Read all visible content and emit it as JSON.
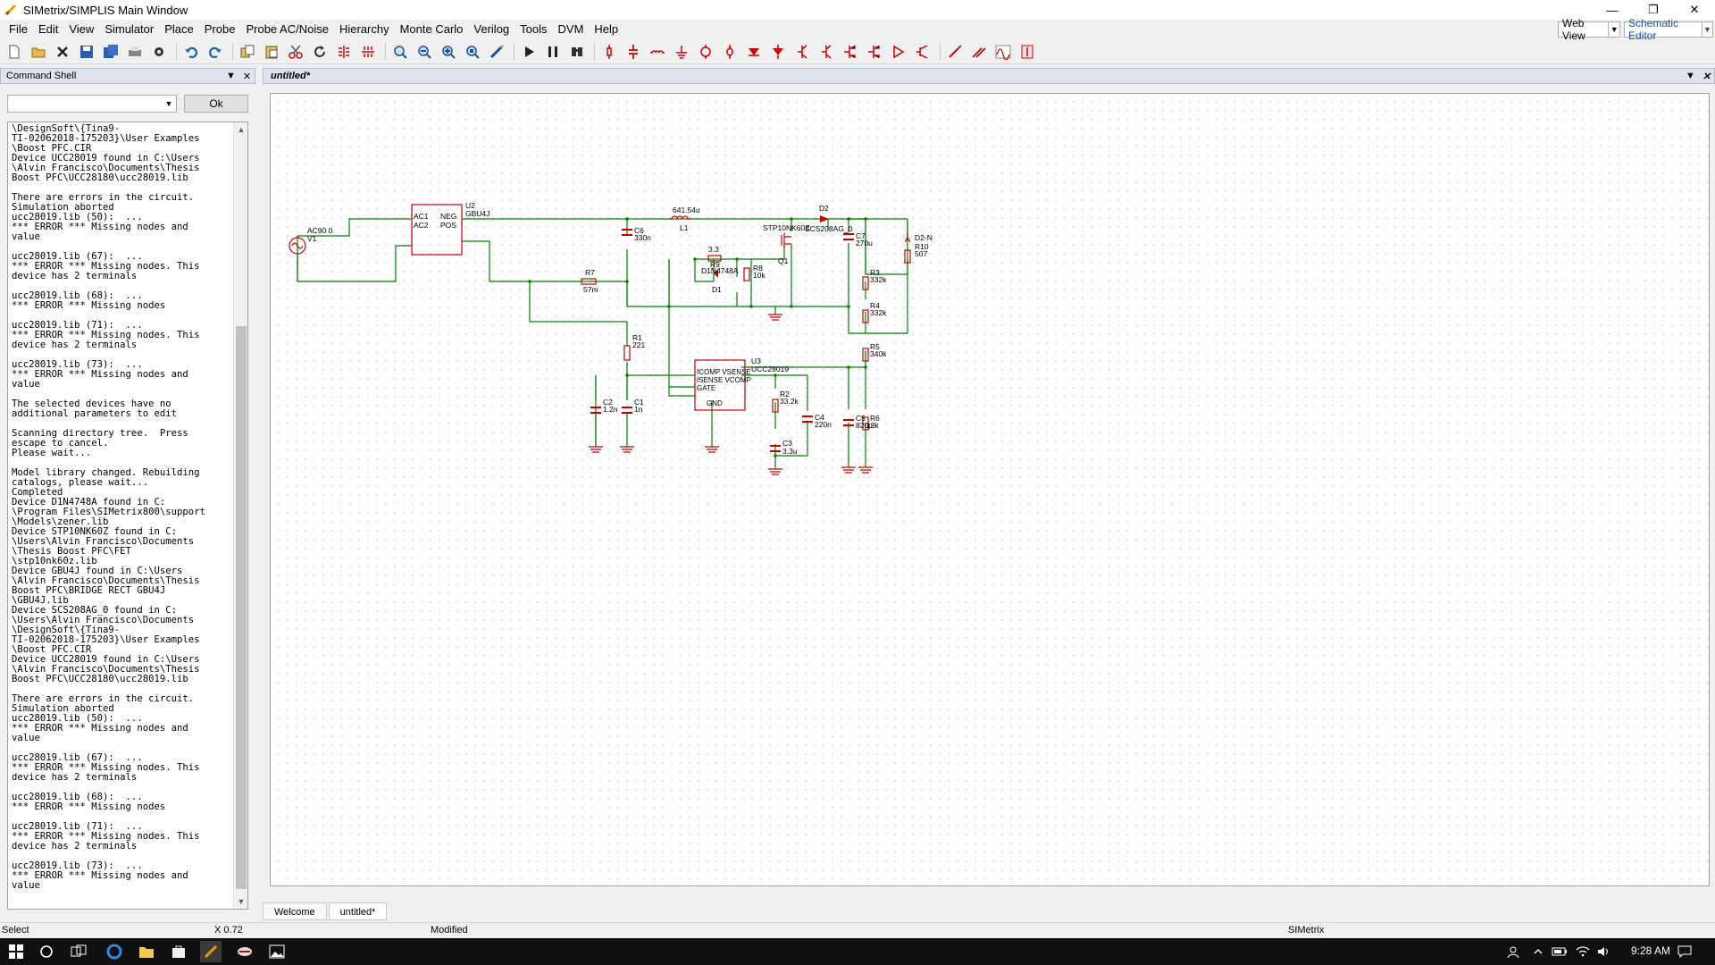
{
  "window": {
    "title": "SIMetrix/SIMPLIS Main Window",
    "min": "—",
    "max": "❐",
    "close": "✕"
  },
  "menu": {
    "items": [
      "File",
      "Edit",
      "View",
      "Simulator",
      "Place",
      "Probe",
      "Probe AC/Noise",
      "Hierarchy",
      "Monte Carlo",
      "Verilog",
      "Tools",
      "DVM",
      "Help"
    ],
    "web_view": "Web View",
    "editor": "Schematic Editor"
  },
  "toolbar": {
    "icons": [
      "new-icon",
      "open-icon",
      "close-icon",
      "save-icon",
      "save-all-icon",
      "print-icon",
      "options-icon",
      "undo-icon",
      "redo-icon",
      "copy-icon",
      "paste-icon",
      "cut-icon",
      "rotate-icon",
      "mirror-icon",
      "flip-icon",
      "zoom-box-icon",
      "zoom-out-icon",
      "zoom-in-icon",
      "zoom-fit-icon",
      "draw-wire-icon",
      "run-icon",
      "pause-icon",
      "find-icon",
      "resistor-icon",
      "capacitor-icon",
      "inductor-icon",
      "ground-icon",
      "source-icon",
      "diode-icon",
      "npn-icon",
      "pnp-icon",
      "nmos-icon",
      "pmos-icon",
      "njfet-icon",
      "pjfet-icon",
      "opamp-icon",
      "switch-icon",
      "comparator-icon",
      "buffer-icon",
      "probe-icon",
      "probe-diff-icon",
      "waveform-icon",
      "meter-icon"
    ]
  },
  "command_shell": {
    "title": "Command Shell",
    "ok": "Ok",
    "log": "\\DesignSoft\\{Tina9-\nTI-02062018-175203}\\User Examples\n\\Boost PFC.CIR\nDevice UCC28019 found in C:\\Users\n\\Alvin Francisco\\Documents\\Thesis\nBoost PFC\\UCC28180\\ucc28019.lib\n\nThere are errors in the circuit.\nSimulation aborted\nucc28019.lib (50):  ...\n*** ERROR *** Missing nodes and\nvalue\n\nucc28019.lib (67):  ...\n*** ERROR *** Missing nodes. This\ndevice has 2 terminals\n\nucc28019.lib (68):  ...\n*** ERROR *** Missing nodes\n\nucc28019.lib (71):  ...\n*** ERROR *** Missing nodes. This\ndevice has 2 terminals\n\nucc28019.lib (73):  ...\n*** ERROR *** Missing nodes and\nvalue\n\nThe selected devices have no\nadditional parameters to edit\n\nScanning directory tree.  Press\nescape to cancel.\nPlease wait...\n\nModel library changed. Rebuilding\ncatalogs, please wait...\nCompleted\nDevice D1N4748A found in C:\n\\Program Files\\SIMetrix800\\support\n\\Models\\zener.lib\nDevice STP10NK60Z found in C:\n\\Users\\Alvin Francisco\\Documents\n\\Thesis Boost PFC\\FET\n\\stp10nk60z.lib\nDevice GBU4J found in C:\\Users\n\\Alvin Francisco\\Documents\\Thesis\nBoost PFC\\BRIDGE RECT GBU4J\n\\GBU4J.lib\nDevice SCS208AG_0 found in C:\n\\Users\\Alvin Francisco\\Documents\n\\DesignSoft\\{Tina9-\nTI-02062018-175203}\\User Examples\n\\Boost PFC.CIR\nDevice UCC28019 found in C:\\Users\n\\Alvin Francisco\\Documents\\Thesis\nBoost PFC\\UCC28180\\ucc28019.lib\n\nThere are errors in the circuit.\nSimulation aborted\nucc28019.lib (50):  ...\n*** ERROR *** Missing nodes and\nvalue\n\nucc28019.lib (67):  ...\n*** ERROR *** Missing nodes. This\ndevice has 2 terminals\n\nucc28019.lib (68):  ...\n*** ERROR *** Missing nodes\n\nucc28019.lib (71):  ...\n*** ERROR *** Missing nodes. This\ndevice has 2 terminals\n\nucc28019.lib (73):  ...\n*** ERROR *** Missing nodes and\nvalue"
  },
  "schematic": {
    "title": "untitled*",
    "labels": {
      "v1_val": "AC90 0",
      "v1": "V1",
      "u2_ac1": "AC1",
      "u2_ac2": "AC2",
      "u2_neg": "NEG",
      "u2_pos": "POS",
      "u2": "U2",
      "u2_part": "GBU4J",
      "l1_val": "641.54u",
      "l1": "L1",
      "c6": "C6",
      "c6_val": "330n",
      "r7": "R7",
      "r7_val": "57m",
      "r9_val": "3.3",
      "r9": "R9",
      "d1_part": "D1N4748A",
      "d1": "D1",
      "r8": "R8",
      "r8_val": "10k",
      "q1_part": "STP10NK60Z",
      "q1": "Q1",
      "d2": "D2",
      "d2_part": "SCS208AG_0",
      "c7": "C7",
      "c7_val": "270u",
      "d2n": "D2-N",
      "r10": "R10",
      "r10_val": "507",
      "r3": "R3",
      "r3_val": "332k",
      "r4": "R4",
      "r4_val": "332k",
      "r5": "R5",
      "r5_val": "340k",
      "r1": "R1",
      "r1_val": "221",
      "u3": "U3",
      "u3_part": "UCC28019",
      "u3_p1": "ICOMP VSENSE",
      "u3_p2": "ISENSE VCOMP",
      "u3_p3": "GATE",
      "u3_p4": "GND",
      "c2": "C2",
      "c2_val": "1.2n",
      "c1": "C1",
      "c1_val": "1n",
      "r2": "R2",
      "r2_val": "33.2k",
      "c4": "C4",
      "c4_val": "220n",
      "c3": "C3",
      "c3_val": "3.3u",
      "c5": "C5",
      "c5_val": "820p",
      "r6": "R6",
      "r6_val": "13k"
    }
  },
  "tabs": [
    "Welcome",
    "untitled*"
  ],
  "status": {
    "mode": "Select",
    "coord": "X 0.72",
    "modified": "Modified",
    "app": "SIMetrix"
  },
  "taskbar": {
    "time": "9:28 AM"
  },
  "colors": {
    "wire": "#008000",
    "component": "#c00000",
    "text": "#000000",
    "header": "#dde4ee"
  }
}
